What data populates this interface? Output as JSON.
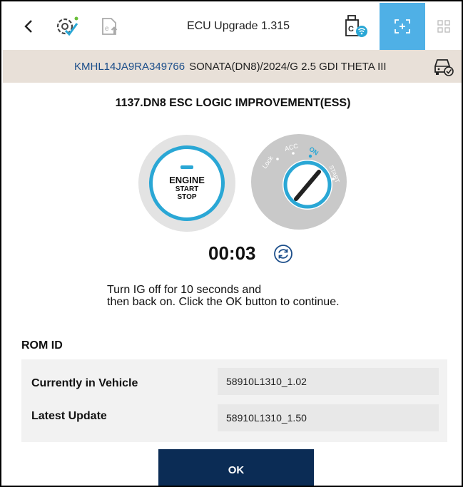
{
  "header": {
    "back_label": "<",
    "title": "ECU Upgrade 1.315"
  },
  "icons": {
    "back": "chevron-left-icon",
    "diagnosis": "diagnosis-check-icon",
    "ecu_update": "ecu-upgrade-icon",
    "vci": "vci-wireless-icon",
    "scan": "scan-bracket-icon",
    "grid": "grid-icon",
    "vehicle": "vehicle-check-icon",
    "refresh": "refresh-icon"
  },
  "colors": {
    "accent": "#2aa7d5",
    "active_tab": "#4fb0e6",
    "vin": "#1c4e8a",
    "vehicle_bar": "#e8e0d8",
    "ok_button": "#0b2c55"
  },
  "vehicle": {
    "vin": "KMHL14JA9RA349766",
    "model": "SONATA(DN8)/2024/G 2.5 GDI THETA III"
  },
  "procedure": {
    "title": "1137.DN8 ESC LOGIC IMPROVEMENT(ESS)"
  },
  "engine_button": {
    "line1": "ENGINE",
    "line2": "START",
    "line3": "STOP"
  },
  "ignition": {
    "lock": "Lock",
    "acc": "ACC",
    "on": "ON",
    "start": "START"
  },
  "timer": {
    "value": "00:03"
  },
  "instruction": {
    "line1": "Turn IG off for 10 seconds and",
    "line2": "then back on. Click the OK button to continue."
  },
  "rom": {
    "heading": "ROM ID",
    "rows": [
      {
        "label": "Currently in Vehicle",
        "value": "58910L1310_1.02"
      },
      {
        "label": "Latest Update",
        "value": "58910L1310_1.50"
      }
    ]
  },
  "ok_label": "OK"
}
